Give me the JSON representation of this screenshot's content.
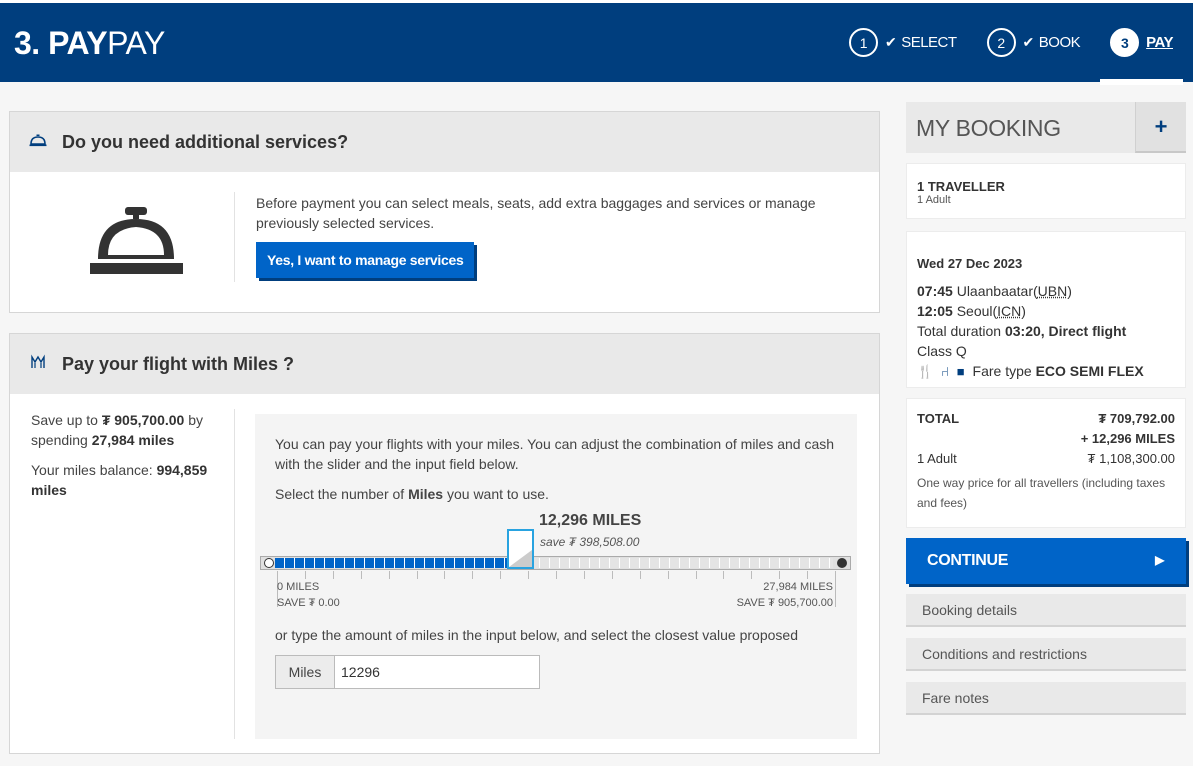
{
  "header": {
    "step_number": "3.",
    "title_bold": "PAY",
    "title_light": "PAY",
    "steps": [
      {
        "num": "1",
        "label": "SELECT",
        "done": true
      },
      {
        "num": "2",
        "label": "BOOK",
        "done": true
      },
      {
        "num": "3",
        "label": "PAY",
        "done": false
      }
    ]
  },
  "services": {
    "title": "Do you need additional services?",
    "icon": "bell-icon",
    "description": "Before payment you can select meals, seats, add extra baggages and services or manage previously selected services.",
    "button_label": "Yes, I want to manage services"
  },
  "miles": {
    "title": "Pay your flight with Miles ?",
    "icon": "miles-icon",
    "save_prefix": "Save up to",
    "save_amount": "₮ 905,700.00",
    "save_by": "by spending",
    "save_miles": "27,984 miles",
    "balance_label": "Your miles balance:",
    "balance_value": "994,859",
    "balance_unit": "miles",
    "intro": "You can pay your flights with your miles. You can adjust the combination of miles and cash with the slider and the input field below.",
    "select_prefix": "Select the number of",
    "select_bold": "Miles",
    "select_suffix": "you want to use.",
    "slider": {
      "value_label": "12,296 MILES",
      "save_label": "save ₮ 398,508.00",
      "min_miles": "0 MILES",
      "min_save": "SAVE ₮ 0.00",
      "max_miles": "27,984 MILES",
      "max_save": "SAVE ₮ 905,700.00",
      "value": 12296,
      "min": 0,
      "max": 27984
    },
    "type_text": "or type the amount of miles in the input below, and select the closest value proposed",
    "input_label": "Miles",
    "input_value": "12296"
  },
  "booking": {
    "title": "MY BOOKING",
    "expand_label": "+",
    "travellers": "1 TRAVELLER",
    "travellers_detail": "1 Adult",
    "date": "Wed 27 Dec 2023",
    "dep_time": "07:45",
    "dep_city": "Ulaanbaatar(",
    "dep_code": "UBN",
    "arr_time": "12:05",
    "arr_city": "Seoul(",
    "arr_code": "ICN",
    "duration_label": "Total duration",
    "duration_value": "03:20, Direct flight",
    "class": "Class Q",
    "fare_type_label": "Fare type",
    "fare_type_value": "ECO SEMI FLEX",
    "total_label": "TOTAL",
    "total_cash": "₮ 709,792.00",
    "total_miles": "+  12,296 MILES",
    "adult_label": "1 Adult",
    "adult_price": "₮ 1,108,300.00",
    "price_note": "One way price for all travellers (including taxes and fees)",
    "continue_label": "CONTINUE",
    "links": [
      "Booking details",
      "Conditions and restrictions",
      "Fare notes"
    ]
  },
  "colors": {
    "brand": "#003e7e",
    "accent": "#0064c8"
  }
}
